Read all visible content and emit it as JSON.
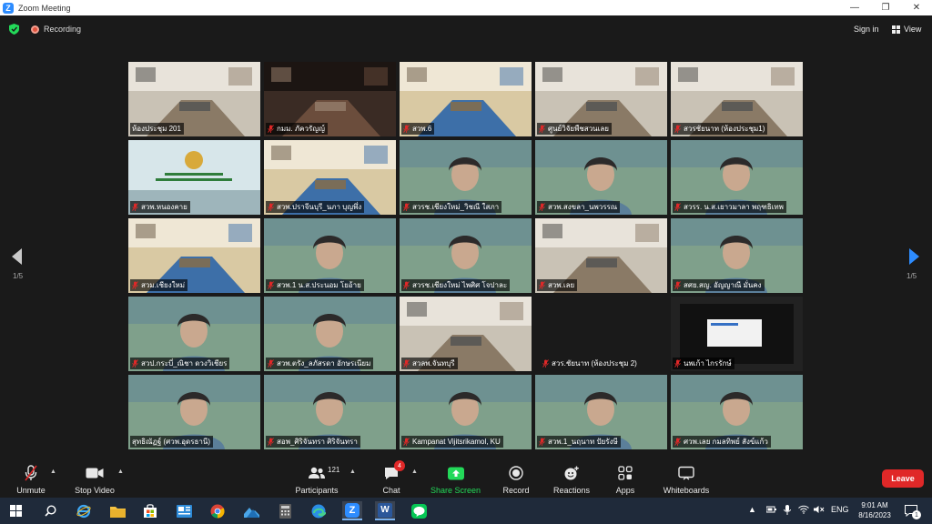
{
  "window": {
    "title": "Zoom Meeting",
    "logo": "Z",
    "minimize": "—",
    "restore": "❐",
    "close": "✕"
  },
  "topbar": {
    "recording": "Recording",
    "signin": "Sign in",
    "view": "View"
  },
  "pager": {
    "left": "1/5",
    "right": "1/5"
  },
  "tiles": [
    {
      "name": "ห้องประชุม 201",
      "active": true,
      "muted": false,
      "scene": "room"
    },
    {
      "name": "กมม. ภัควรัญญ์",
      "muted": true,
      "scene": "dark"
    },
    {
      "name": "สวพ.6",
      "muted": true,
      "scene": "office"
    },
    {
      "name": "ศูนย์วิจัยพืชสวนเลย",
      "muted": true,
      "scene": "room"
    },
    {
      "name": "สวรชัยนาท (ห้องประชุม1)",
      "muted": true,
      "scene": "room"
    },
    {
      "name": "สวพ.หนองคาย",
      "muted": true,
      "scene": "sign"
    },
    {
      "name": "สวพ.ปราจีนบุรี_นภา บุญพึ่ง",
      "muted": true,
      "scene": "office"
    },
    {
      "name": "สวรช.เชียงใหม่_วิชณี ใสภา",
      "muted": true,
      "scene": "person"
    },
    {
      "name": "สวพ.สงขลา_นพวรรณ",
      "muted": true,
      "scene": "person"
    },
    {
      "name": "สวรร. น.ส.เยาวมาลา พฤฑธิเทพ",
      "muted": true,
      "scene": "person"
    },
    {
      "name": "สวม.เชียงใหม่",
      "muted": true,
      "scene": "office"
    },
    {
      "name": "สวพ.1 น.ส.ประนอม โยอ้าย",
      "muted": true,
      "scene": "person"
    },
    {
      "name": "สวรช.เชียงใหม่ ไพศิศ โจปาละ",
      "muted": true,
      "scene": "person"
    },
    {
      "name": "สวพ.เลย",
      "muted": true,
      "scene": "room"
    },
    {
      "name": "สศย.สญ. อัญญาณี มั่นคง",
      "muted": true,
      "scene": "person"
    },
    {
      "name": "สวป.กระบี่_ณิชา ดวงวิเชียร",
      "muted": true,
      "scene": "person"
    },
    {
      "name": "สวพ.ตรัง_ลภัสรดา อักษรเนียม",
      "muted": true,
      "scene": "person"
    },
    {
      "name": "สวลพ.จันทบุรี",
      "muted": true,
      "scene": "room"
    },
    {
      "name": "สวร.ชัยนาท (ห้องประชุม 2)",
      "muted": true,
      "scene": "empty"
    },
    {
      "name": "นพเก้า ไกรรักษ์",
      "muted": true,
      "scene": "screen"
    },
    {
      "name": "สุทธิณัฏฐ์ (ศวพ.อุดรธานี)",
      "muted": false,
      "scene": "person"
    },
    {
      "name": "สอพ_ศิริจันทรา ศิริจันทรา",
      "muted": true,
      "scene": "person"
    },
    {
      "name": "Kampanat Vijitsrikamol, KU",
      "muted": true,
      "scene": "person"
    },
    {
      "name": "สวพ.1_นฤนาท ปัยรังษี",
      "muted": true,
      "scene": "person"
    },
    {
      "name": "ศวพ.เลย กมลทิพย์ สังข์แก้ว",
      "muted": true,
      "scene": "person"
    }
  ],
  "toolbar": {
    "unmute": "Unmute",
    "stop_video": "Stop Video",
    "participants": "Participants",
    "participant_count": "121",
    "chat": "Chat",
    "chat_badge": "4",
    "share": "Share Screen",
    "record": "Record",
    "reactions": "Reactions",
    "apps": "Apps",
    "whiteboards": "Whiteboards",
    "leave": "Leave"
  },
  "taskbar": {
    "lang": "ENG",
    "time": "9:01 AM",
    "date": "8/16/2023",
    "word_letter": "W",
    "zoom_letter": "Z",
    "notif_count": "1"
  },
  "colors": {
    "accent": "#2d8cff",
    "leave": "#e02828",
    "share": "#23d959",
    "active_outline": "#c7d93a"
  }
}
